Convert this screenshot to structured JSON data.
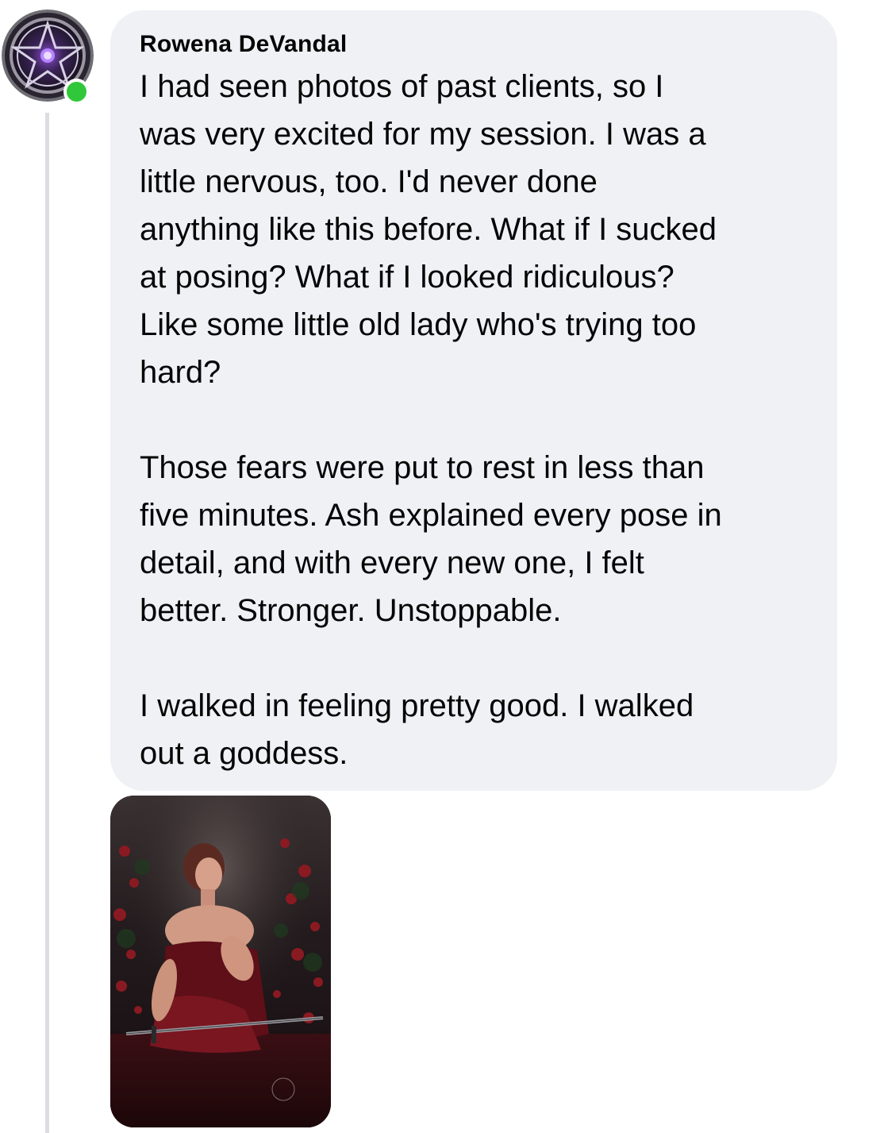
{
  "comment": {
    "author": "Rowena DeVandal",
    "paragraphs": [
      "I had seen photos of past clients, so I\nwas very excited for my session. I was a\nlittle nervous, too. I'd never done\nanything like this before. What if I sucked\nat posing? What if I looked ridiculous?\nLike some little old lady who's trying too\nhard?",
      "Those fears were put to rest in less than\nfive minutes. Ash explained every pose in\ndetail, and with every new one, I felt\nbetter. Stronger. Unstoppable.",
      "I walked in feeling pretty good. I walked\nout a goddess."
    ],
    "online_status_color": "#30c83a",
    "bubble_color": "#f0f1f5",
    "avatar_icon": "pentagram-icon",
    "attachment": "photo"
  }
}
